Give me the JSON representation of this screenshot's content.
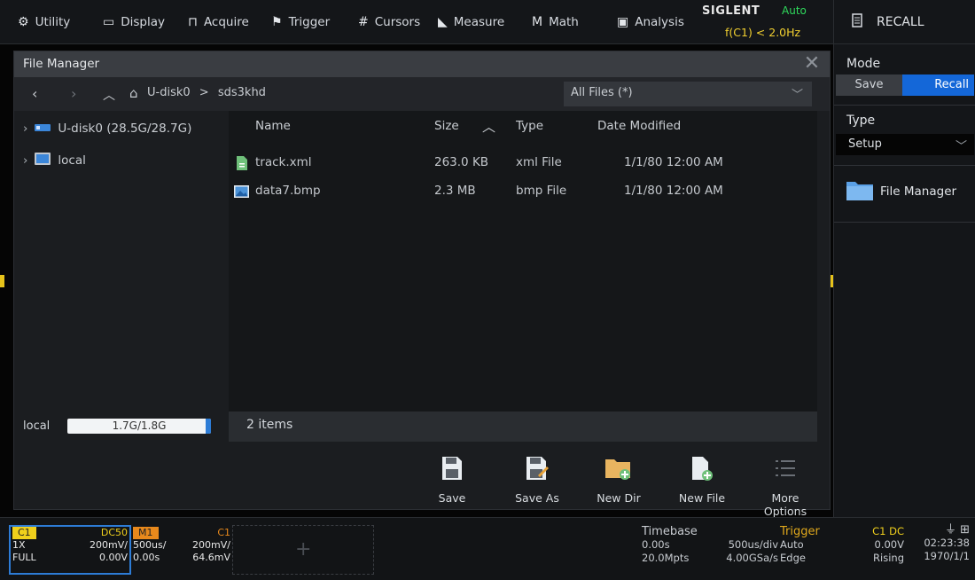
{
  "menu": {
    "items": [
      {
        "icon": "gear-icon",
        "glyph": "⚙",
        "label": "Utility"
      },
      {
        "icon": "monitor-icon",
        "glyph": "▭",
        "label": "Display"
      },
      {
        "icon": "acquire-icon",
        "glyph": "⊓",
        "label": "Acquire"
      },
      {
        "icon": "flag-icon",
        "glyph": "⚑",
        "label": "Trigger"
      },
      {
        "icon": "cursors-icon",
        "glyph": "#",
        "label": "Cursors"
      },
      {
        "icon": "measure-icon",
        "glyph": "◣",
        "label": "Measure"
      },
      {
        "icon": "math-icon",
        "glyph": "M",
        "label": "Math"
      },
      {
        "icon": "analysis-icon",
        "glyph": "▣",
        "label": "Analysis"
      }
    ],
    "brand": "SIGLENT",
    "mode": "Auto",
    "freq": "f(C1) < 2.0Hz",
    "panel_title": "RECALL"
  },
  "file_manager": {
    "title": "File Manager",
    "path_root": "U-disk0",
    "path_sep": ">",
    "path_dir": "sds3khd",
    "filter": "All Files (*)",
    "tree": [
      {
        "label": "U-disk0 (28.5G/28.7G)",
        "icon": "usb-drive-icon"
      },
      {
        "label": "local",
        "icon": "local-drive-icon"
      }
    ],
    "columns": {
      "name": "Name",
      "size": "Size",
      "type": "Type",
      "date": "Date Modified"
    },
    "files": [
      {
        "name": "track.xml",
        "size": "263.0 KB",
        "type": "xml File",
        "date": "1/1/80 12:00 AM",
        "icon": "xml-file-icon"
      },
      {
        "name": "data7.bmp",
        "size": "2.3 MB",
        "type": "bmp File",
        "date": "1/1/80 12:00 AM",
        "icon": "image-file-icon"
      }
    ],
    "storage_label": "local",
    "storage_value": "1.7G/1.8G",
    "storage_fraction": 0.94,
    "item_count": "2 items",
    "toolbar": [
      {
        "label": "Save",
        "icon": "save-icon"
      },
      {
        "label": "Save As",
        "icon": "save-as-icon"
      },
      {
        "label": "New Dir",
        "icon": "new-folder-icon"
      },
      {
        "label": "New File",
        "icon": "new-file-icon"
      },
      {
        "label": "More Options",
        "icon": "more-options-icon"
      }
    ]
  },
  "side": {
    "mode_label": "Mode",
    "save_label": "Save",
    "recall_label": "Recall",
    "type_label": "Type",
    "type_value": "Setup",
    "file_manager_label": "File Manager"
  },
  "bottom": {
    "c1": {
      "name": "C1",
      "coupling": "DC50",
      "probe": "1X",
      "scale": "200mV/",
      "bw": "FULL",
      "offset": "0.00V"
    },
    "m1": {
      "name": "M1",
      "src": "C1",
      "time": "500us/",
      "vscale": "200mV/",
      "toff": "0.00s",
      "voff": "64.6mV"
    },
    "timebase": {
      "label": "Timebase",
      "delay": "0.00s",
      "scale": "500us/div",
      "depth": "20.0Mpts",
      "rate": "4.00GSa/s"
    },
    "trigger": {
      "label": "Trigger",
      "source": "C1 DC",
      "mode": "Auto",
      "level": "0.00V",
      "type": "Edge",
      "slope": "Rising"
    },
    "clock": {
      "time": "02:23:38",
      "date": "1970/1/1"
    },
    "colors": {
      "c1": "#f0d01c",
      "m1": "#e8891c",
      "trigger": "#e0a81c"
    }
  }
}
